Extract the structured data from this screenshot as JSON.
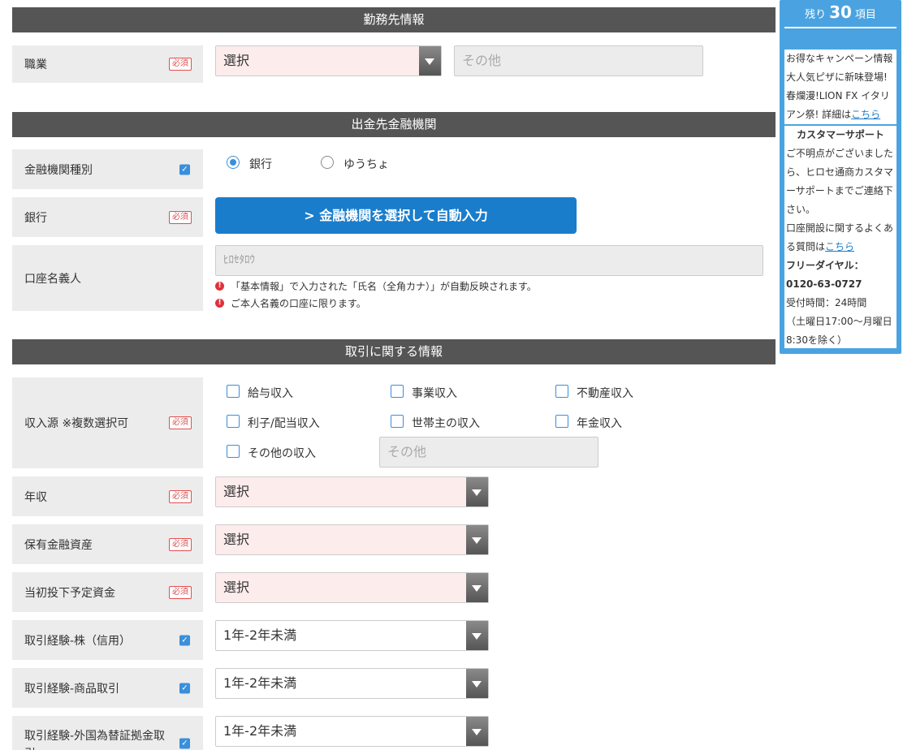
{
  "sections": {
    "employer": "勤務先情報",
    "bank": "出金先金融機関",
    "trade": "取引に関する情報"
  },
  "required_badge": "必須",
  "checked_mark": "✓",
  "occupation": {
    "label": "職業",
    "select_value": "選択",
    "other_placeholder": "その他"
  },
  "institution_type": {
    "label": "金融機関種別",
    "options": [
      "銀行",
      "ゆうちょ"
    ],
    "selected": "銀行"
  },
  "bank": {
    "label": "銀行",
    "button_label": "> 金融機関を選択して自動入力"
  },
  "account_holder": {
    "label": "口座名義人",
    "value": "ﾋﾛｾﾀﾛｳ",
    "notes": [
      "「基本情報」で入力された「氏名（全角カナ）」が自動反映されます。",
      "ご本人名義の口座に限ります。"
    ]
  },
  "income_source": {
    "label": "収入源 ※複数選択可",
    "options": [
      "給与収入",
      "事業収入",
      "不動産収入",
      "利子/配当収入",
      "世帯主の収入",
      "年金収入",
      "その他の収入"
    ],
    "other_placeholder": "その他"
  },
  "annual_income": {
    "label": "年収",
    "value": "選択"
  },
  "financial_assets": {
    "label": "保有金融資産",
    "value": "選択"
  },
  "initial_investment": {
    "label": "当初投下予定資金",
    "value": "選択"
  },
  "exp_stock": {
    "label": "取引経験-株（信用）",
    "value": "1年-2年未満"
  },
  "exp_commodity": {
    "label": "取引経験-商品取引",
    "value": "1年-2年未満"
  },
  "exp_fx": {
    "label": "取引経験-外国為替証拠金取引",
    "value": "1年-2年未満"
  },
  "sidebar": {
    "remain_prefix": "残り",
    "remain_count": "30",
    "remain_suffix": "項目",
    "campaign_title": "お得なキャンペーン情報",
    "campaign_text": "大人気ピザに新味登場!春爛漫!LION FX イタリアン祭! 詳細は",
    "campaign_link": "こちら",
    "support_title": "カスタマーサポート",
    "support_text": "ご不明点がございましたら、ヒロセ通商カスタマーサポートまでご連絡下さい。",
    "faq_text": "口座開設に関するよくある質問は",
    "faq_link": "こちら",
    "freedial_label": "フリーダイヤル：",
    "freedial_number": "0120-63-0727",
    "hours": "受付時間：24時間",
    "hours_note": "（土曜日17:00〜月曜日8:30を除く）"
  },
  "colors": {
    "section_bar": "#555555",
    "accent_blue": "#1a7dcc",
    "sidebar_blue": "#4aa3e0",
    "required_red": "#e05050",
    "select_pink": "#fdecec"
  }
}
